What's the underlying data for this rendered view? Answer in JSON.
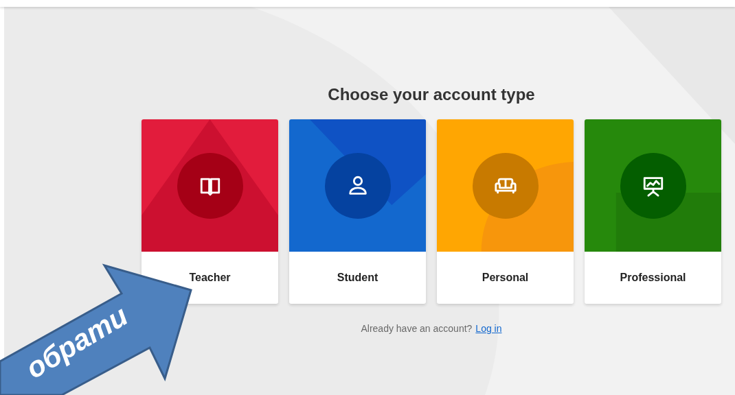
{
  "title": "Choose your account type",
  "cards": [
    {
      "kind": "book",
      "label": "Teacher",
      "color": "#e21c3c"
    },
    {
      "kind": "person",
      "label": "Student",
      "color": "#1368ce"
    },
    {
      "kind": "sofa",
      "label": "Personal",
      "color": "#ffa602"
    },
    {
      "kind": "presentation",
      "label": "Professional",
      "color": "#26890c"
    }
  ],
  "login_prompt": {
    "text": "Already have an account?",
    "link": "Log in"
  },
  "annotation": {
    "label": "обрати"
  }
}
